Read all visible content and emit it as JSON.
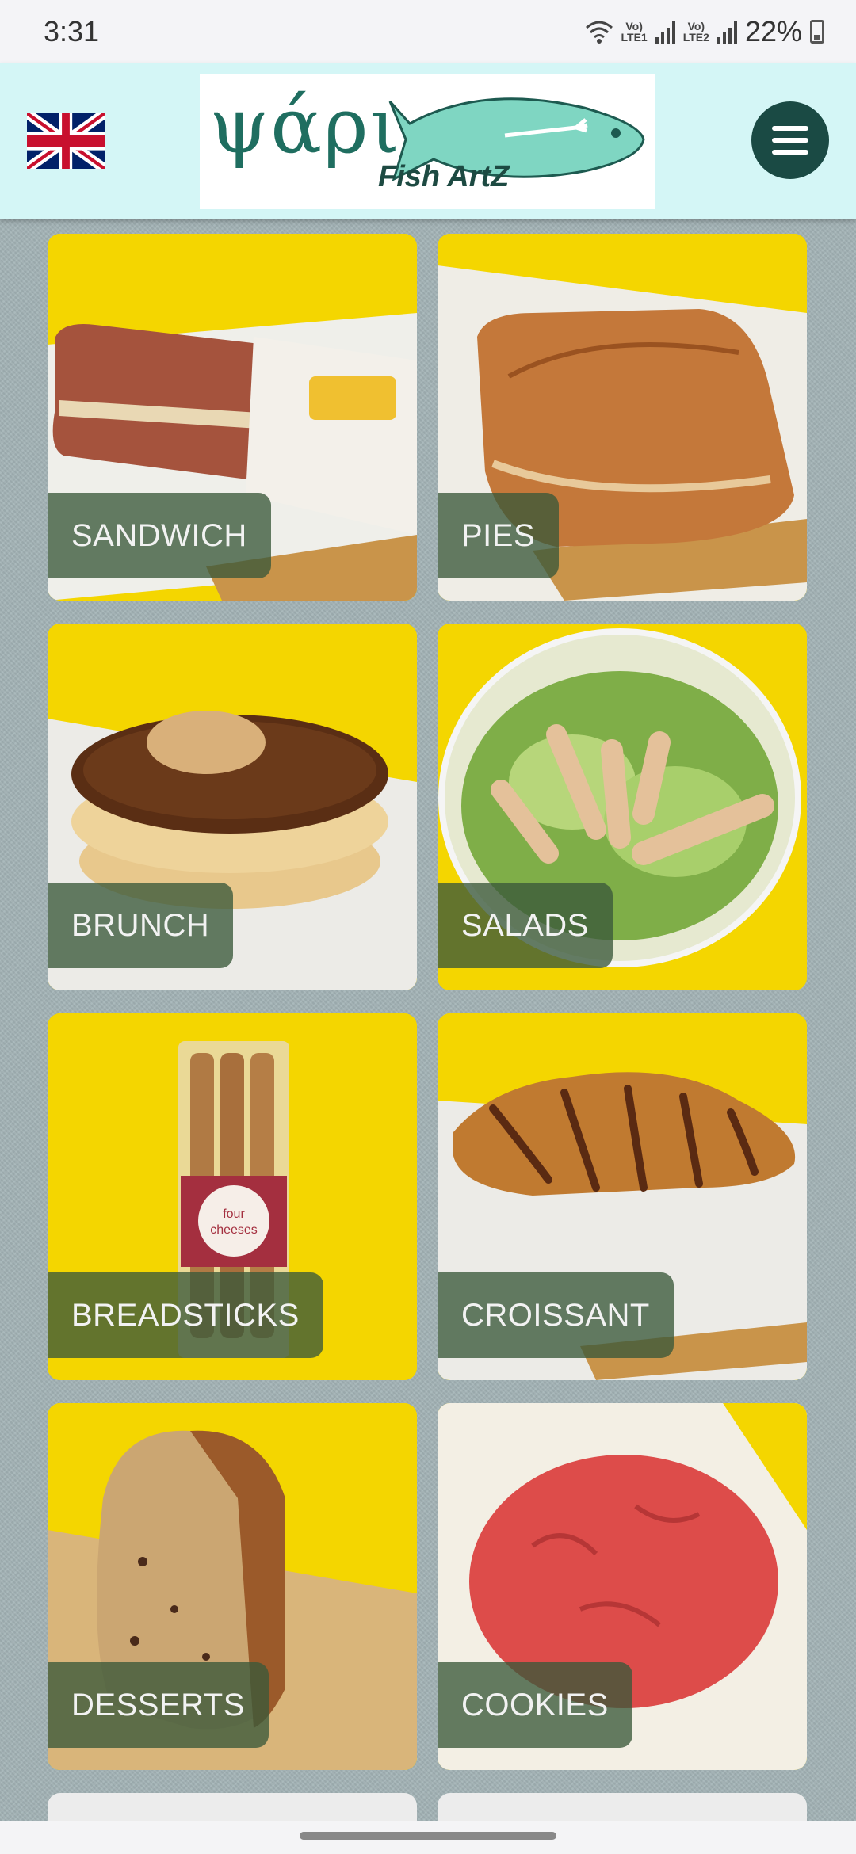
{
  "status_bar": {
    "time": "3:31",
    "battery": "22%",
    "sim1": "Vo)) LTE1",
    "sim2": "Vo)) LTE2"
  },
  "header": {
    "language_flag": "uk-flag-icon",
    "logo_text": "ψάρι",
    "logo_subtitle": "Fish ArtZ",
    "menu_icon": "hamburger-menu-icon"
  },
  "categories": [
    {
      "label": "SANDWICH"
    },
    {
      "label": "PIES"
    },
    {
      "label": "BRUNCH"
    },
    {
      "label": "SALADS"
    },
    {
      "label": "BREADSTICKS"
    },
    {
      "label": "CROISSANT"
    },
    {
      "label": "DESSERTS"
    },
    {
      "label": "COOKIES"
    }
  ],
  "product_package_text": "four cheeses",
  "colors": {
    "header_bg": "#d4f6f6",
    "card_bg": "#f5d800",
    "label_bg": "#3a583a",
    "menu_button": "#1a4a44"
  }
}
